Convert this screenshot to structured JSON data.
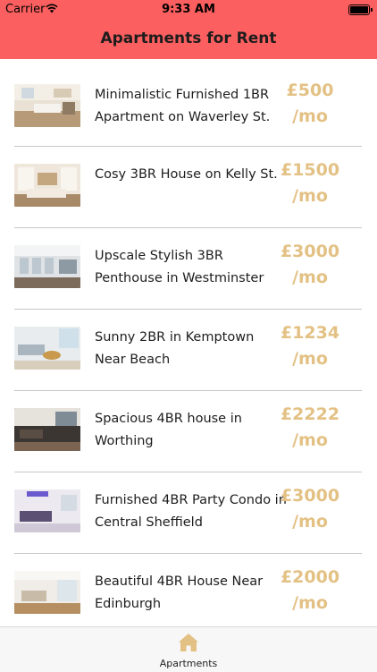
{
  "status_bar": {
    "carrier": "Carrier",
    "time": "9:33 AM"
  },
  "header": {
    "title": "Apartments for Rent",
    "background": "#fb5f5f"
  },
  "listings": [
    {
      "title": "Minimalistic Furnished 1BR Apartment on Waverley St.",
      "price": "£500",
      "unit": "/mo"
    },
    {
      "title": "Cosy 3BR House on Kelly St.",
      "price": "£1500",
      "unit": "/mo"
    },
    {
      "title": "Upscale Stylish 3BR Penthouse in Westminster",
      "price": "£3000",
      "unit": "/mo"
    },
    {
      "title": "Sunny 2BR in Kemptown Near Beach",
      "price": "£1234",
      "unit": "/mo"
    },
    {
      "title": "Spacious 4BR house in Worthing",
      "price": "£2222",
      "unit": "/mo"
    },
    {
      "title": "Furnished 4BR Party Condo in Central Sheffield",
      "price": "£3000",
      "unit": "/mo"
    },
    {
      "title": "Beautiful 4BR House Near Edinburgh",
      "price": "£2000",
      "unit": "/mo"
    }
  ],
  "tabbar": {
    "items": [
      {
        "label": "Apartments",
        "icon": "home-icon"
      }
    ],
    "accent": "#e3c184"
  }
}
